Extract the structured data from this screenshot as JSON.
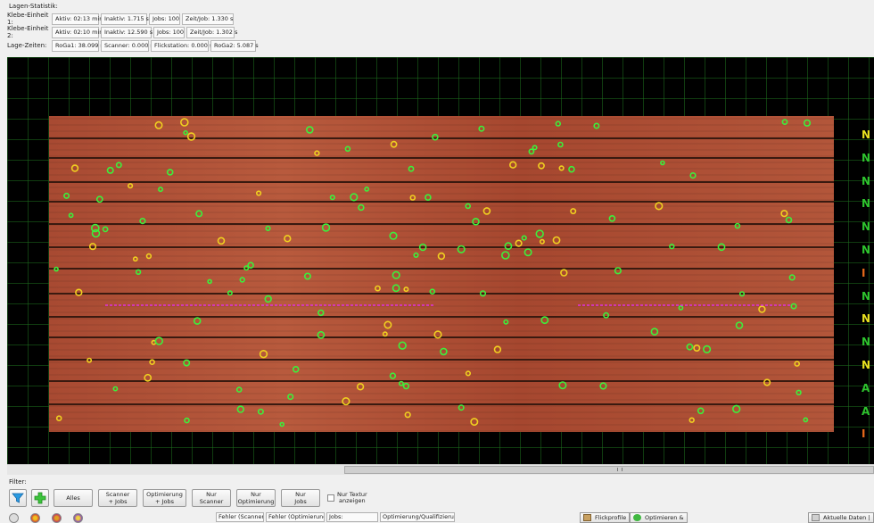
{
  "stats": {
    "title": "Lagen-Statistik:",
    "rows": [
      {
        "label": "Klebe-Einheit 1:",
        "cells": [
          "Aktiv: 02:13 min",
          "Inaktiv: 1.715 s",
          "Jobs: 100",
          "Zeit/Job: 1.330 s"
        ]
      },
      {
        "label": "Klebe-Einheit 2:",
        "cells": [
          "Aktiv: 02:10 min",
          "Inaktiv: 12.590 s",
          "Jobs: 100",
          "Zeit/Job: 1.302 s"
        ]
      },
      {
        "label": "Lage-Zeiten:",
        "cells": [
          "RoGa1: 38.099 s",
          "Scanner: 0.000 s",
          "Flickstation: 0.000 s",
          "RoGa2: 5.087 s"
        ]
      }
    ]
  },
  "viewer": {
    "side_labels": [
      {
        "text": "N",
        "color": "#e8e020"
      },
      {
        "text": "N",
        "color": "#2ec42e"
      },
      {
        "text": "N",
        "color": "#2ec42e"
      },
      {
        "text": "N",
        "color": "#2ec42e"
      },
      {
        "text": "N",
        "color": "#2ec42e"
      },
      {
        "text": "N",
        "color": "#2ec42e"
      },
      {
        "text": "I",
        "color": "#e86a1a"
      },
      {
        "text": "N",
        "color": "#2ec42e"
      },
      {
        "text": "N",
        "color": "#e8e020"
      },
      {
        "text": "N",
        "color": "#2ec42e"
      },
      {
        "text": "N",
        "color": "#e8e020"
      },
      {
        "text": "A",
        "color": "#2ec42e"
      },
      {
        "text": "A",
        "color": "#2ec42e"
      },
      {
        "text": "I",
        "color": "#e86a1a"
      }
    ],
    "marker_colors": {
      "green": "#3cf03c",
      "yellow": "#f0d020",
      "magenta": "#e030e0"
    }
  },
  "filter": {
    "title": "Filter:",
    "buttons": [
      {
        "name": "filter-all-button",
        "label": "Alles",
        "width": 44
      },
      {
        "name": "filter-scanner-jobs-button",
        "label": "Scanner\n+ Jobs",
        "width": 44
      },
      {
        "name": "filter-optimization-jobs-button",
        "label": "Optimierung\n+ Jobs",
        "width": 49
      },
      {
        "name": "filter-only-scanner-button",
        "label": "Nur\nScanner",
        "width": 44
      },
      {
        "name": "filter-only-optimization-button",
        "label": "Nur\nOptimierung",
        "width": 44
      },
      {
        "name": "filter-only-jobs-button",
        "label": "Nur\nJobs",
        "width": 44
      }
    ],
    "texture_checkbox": "Nur Textur\nanzeigen"
  },
  "bottom": {
    "fields": [
      "Fehler (Scanner):",
      "Fehler (Optimierung):",
      "Jobs:",
      "Optimierung/Qualifizierung:"
    ],
    "flick_button": "Flickprofile",
    "optimize_button": "Optimieren &",
    "current_data": "Aktuelle Daten |"
  }
}
